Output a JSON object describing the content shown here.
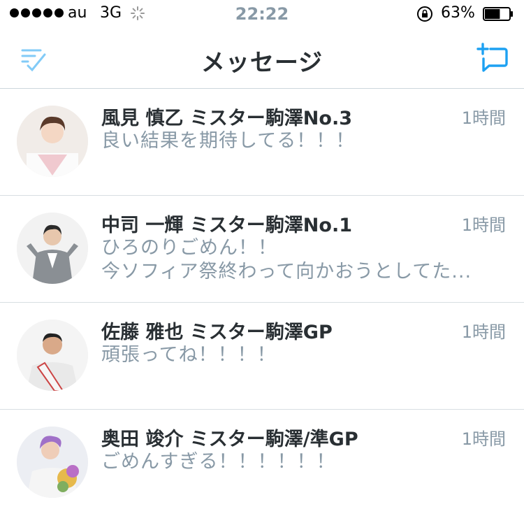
{
  "status_bar": {
    "carrier": "au",
    "network": "3G",
    "time": "22:22",
    "battery_percent": "63%",
    "battery_level": 0.63
  },
  "nav": {
    "title": "メッセージ",
    "accent_color": "#1da1f2"
  },
  "conversations": [
    {
      "name": "風見 慎乙 ミスター駒澤No.3",
      "time": "1時間",
      "message_lines": [
        "良い結果を期待してる！！！"
      ]
    },
    {
      "name": "中司 一輝 ミスター駒澤No.1",
      "time": "1時間",
      "message_lines": [
        "ひろのりごめん！！",
        "今ソフィア祭終わって向かおうとしてた..."
      ]
    },
    {
      "name": "佐藤 雅也 ミスター駒澤GP",
      "time": "1時間",
      "message_lines": [
        "頑張ってね！！！！"
      ]
    },
    {
      "name": "奥田 竣介 ミスター駒澤/準GP",
      "time": "1時間",
      "message_lines": [
        "ごめんすぎる！！！！！！"
      ]
    }
  ]
}
